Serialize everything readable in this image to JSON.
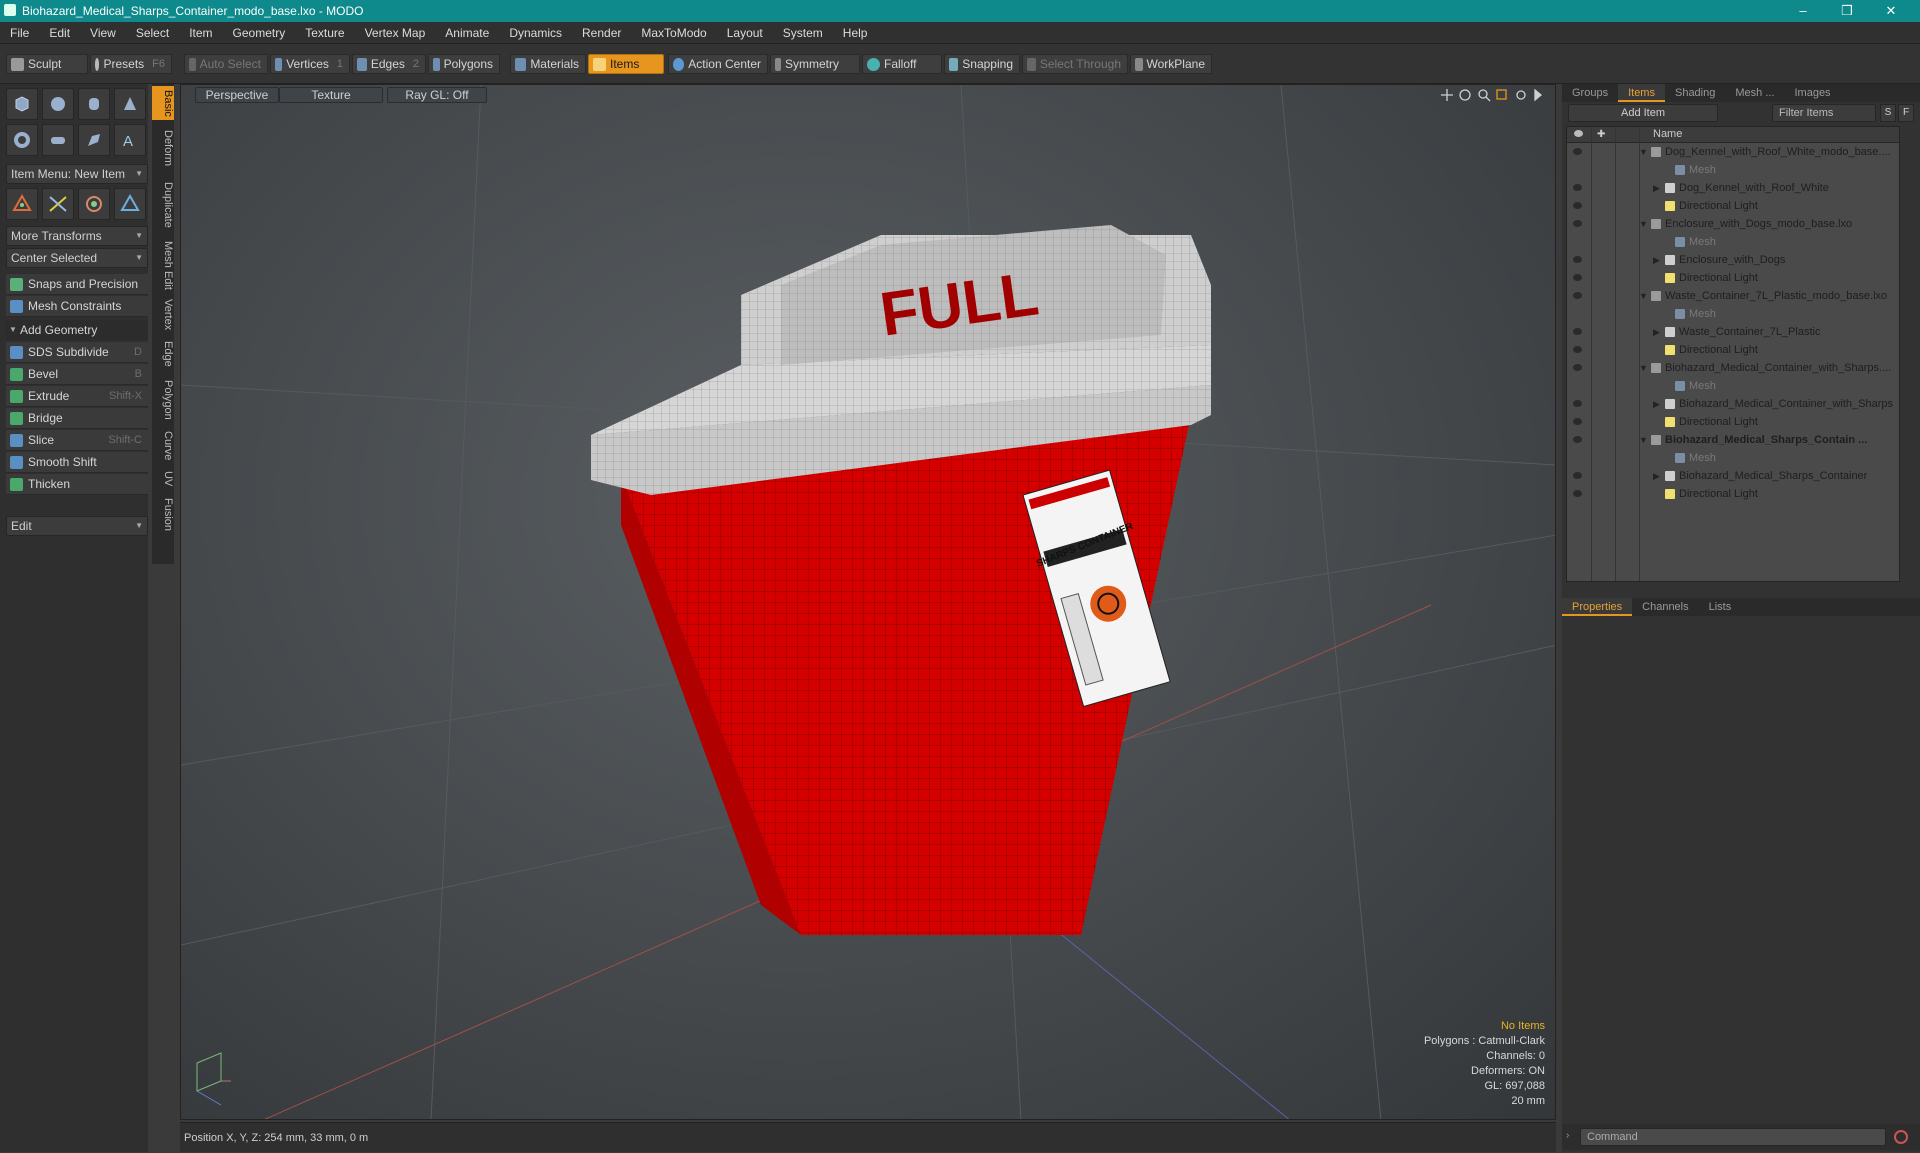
{
  "window": {
    "title": "Biohazard_Medical_Sharps_Container_modo_base.lxo - MODO",
    "minimize": "–",
    "maximize": "❐",
    "close": "✕"
  },
  "menu": [
    "File",
    "Edit",
    "View",
    "Select",
    "Item",
    "Geometry",
    "Texture",
    "Vertex Map",
    "Animate",
    "Dynamics",
    "Render",
    "MaxToModo",
    "Layout",
    "System",
    "Help"
  ],
  "toolbar": {
    "sculpt": "Sculpt",
    "presets": "Presets",
    "presets_key": "F6",
    "auto_select": "Auto Select",
    "vertices": "Vertices",
    "vertices_key": "1",
    "edges": "Edges",
    "edges_key": "2",
    "polygons": "Polygons",
    "materials": "Materials",
    "items": "Items",
    "action_center": "Action Center",
    "symmetry": "Symmetry",
    "falloff": "Falloff",
    "snapping": "Snapping",
    "select_through": "Select Through",
    "workplane": "WorkPlane"
  },
  "left": {
    "item_menu": "Item Menu: New Item",
    "more_transforms": "More Transforms",
    "center_selected": "Center Selected",
    "snaps": "Snaps and Precision",
    "mesh_constraints": "Mesh Constraints",
    "add_geometry": "Add Geometry",
    "tools": [
      {
        "label": "SDS Subdivide",
        "key": "D",
        "color": "#5a8fc4"
      },
      {
        "label": "Bevel",
        "key": "B",
        "color": "#4aa86a"
      },
      {
        "label": "Extrude",
        "key": "Shift-X",
        "color": "#4aa86a"
      },
      {
        "label": "Bridge",
        "key": "",
        "color": "#4aa86a"
      },
      {
        "label": "Slice",
        "key": "Shift-C",
        "color": "#5a8fc4"
      },
      {
        "label": "Smooth Shift",
        "key": "",
        "color": "#5a8fc4"
      },
      {
        "label": "Thicken",
        "key": "",
        "color": "#4aa86a"
      }
    ],
    "edit": "Edit"
  },
  "vtabs": [
    "Basic",
    "Deform",
    "Duplicate",
    "Mesh Edit",
    "Vertex",
    "Edge",
    "Polygon",
    "Curve",
    "UV",
    "Fusion"
  ],
  "viewport": {
    "perspective": "Perspective",
    "texture": "Texture",
    "raygl": "Ray GL: Off",
    "lid_text": "FULL",
    "label_title": "SHARPS CONTAINER",
    "stats": {
      "no_items": "No Items",
      "polygons": "Polygons : Catmull-Clark",
      "channels": "Channels: 0",
      "deformers": "Deformers: ON",
      "gl": "GL: 697,088",
      "scale": "20 mm"
    }
  },
  "status": "Position X, Y, Z:   254 mm, 33 mm, 0 m",
  "right": {
    "tabs": [
      "Groups",
      "Items",
      "Shading",
      "Mesh ...",
      "Images"
    ],
    "add_item": "Add Item",
    "filter": "Filter Items",
    "s": "S",
    "f": "F",
    "name_col": "Name",
    "items": [
      {
        "name": "Dog_Kennel_with_Roof_White_modo_base....",
        "level": 0,
        "kind": "scene"
      },
      {
        "name": "Mesh",
        "level": 2,
        "kind": "mesh"
      },
      {
        "name": "Dog_Kennel_with_Roof_White",
        "level": 1,
        "kind": "group"
      },
      {
        "name": "Directional Light",
        "level": 1,
        "kind": "light"
      },
      {
        "name": "Enclosure_with_Dogs_modo_base.lxo",
        "level": 0,
        "kind": "scene"
      },
      {
        "name": "Mesh",
        "level": 2,
        "kind": "mesh"
      },
      {
        "name": "Enclosure_with_Dogs",
        "level": 1,
        "kind": "group"
      },
      {
        "name": "Directional Light",
        "level": 1,
        "kind": "light"
      },
      {
        "name": "Waste_Container_7L_Plastic_modo_base.lxo",
        "level": 0,
        "kind": "scene"
      },
      {
        "name": "Mesh",
        "level": 2,
        "kind": "mesh"
      },
      {
        "name": "Waste_Container_7L_Plastic",
        "level": 1,
        "kind": "group"
      },
      {
        "name": "Directional Light",
        "level": 1,
        "kind": "light"
      },
      {
        "name": "Biohazard_Medical_Container_with_Sharps....",
        "level": 0,
        "kind": "scene"
      },
      {
        "name": "Mesh",
        "level": 2,
        "kind": "mesh"
      },
      {
        "name": "Biohazard_Medical_Container_with_Sharps",
        "level": 1,
        "kind": "group"
      },
      {
        "name": "Directional Light",
        "level": 1,
        "kind": "light"
      },
      {
        "name": "Biohazard_Medical_Sharps_Contain ...",
        "level": 0,
        "kind": "scene",
        "bold": true
      },
      {
        "name": "Mesh",
        "level": 2,
        "kind": "mesh"
      },
      {
        "name": "Biohazard_Medical_Sharps_Container",
        "level": 1,
        "kind": "group"
      },
      {
        "name": "Directional Light",
        "level": 1,
        "kind": "light"
      }
    ],
    "prop_tabs": [
      "Properties",
      "Channels",
      "Lists"
    ],
    "command": "Command"
  }
}
